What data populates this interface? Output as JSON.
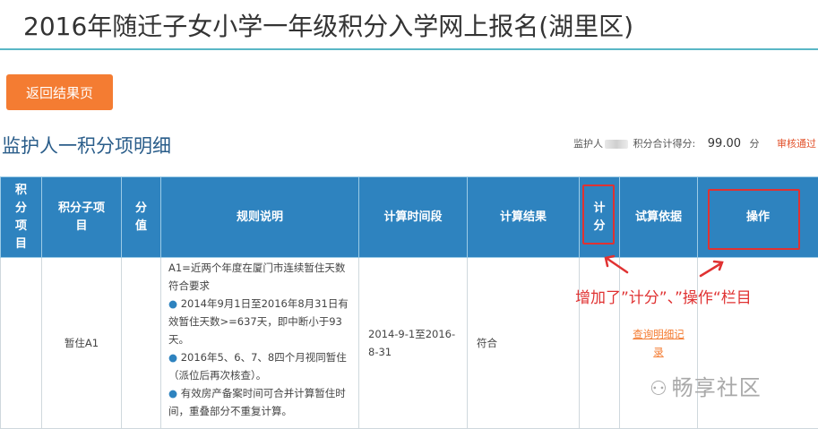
{
  "header": {
    "title": "2016年随迁子女小学一年级积分入学网上报名(湖里区)"
  },
  "toolbar": {
    "back_label": "返回结果页"
  },
  "section": {
    "title": "监护人一积分项明细"
  },
  "summary": {
    "guardian_label": "监护人",
    "total_label": "积分合计得分:",
    "total_value": "99.00",
    "unit": "分",
    "status": "审核通过"
  },
  "table": {
    "headers": [
      "积分项目",
      "积分子项目",
      "分值",
      "规则说明",
      "计算时间段",
      "计算结果",
      "计分",
      "试算依据",
      "操作"
    ],
    "row": {
      "sub_item": "暂住A1",
      "time_range": "2014-9-1至2016-8-31",
      "result": "符合",
      "detail_link": "查询明细记录",
      "rules": [
        "A1=近两个年度在厦门市连续暂住天数符合要求",
        "2014年9月1日至2016年8月31日有效暂住天数>=637天，即中断小于93天。",
        "2016年5、6、7、8四个月视同暂住（派位后再次核查）。",
        "有效房产备案时间可合并计算暂住时间，重叠部分不重复计算。"
      ]
    }
  },
  "annotation": {
    "text": "增加了”计分”、”操作“栏目"
  },
  "watermark": {
    "text": "畅享社区"
  },
  "colors": {
    "header_blue": "#2e83bf",
    "accent_orange": "#f47c32",
    "highlight_red": "#e03232",
    "title_blue": "#2a5d8a"
  }
}
